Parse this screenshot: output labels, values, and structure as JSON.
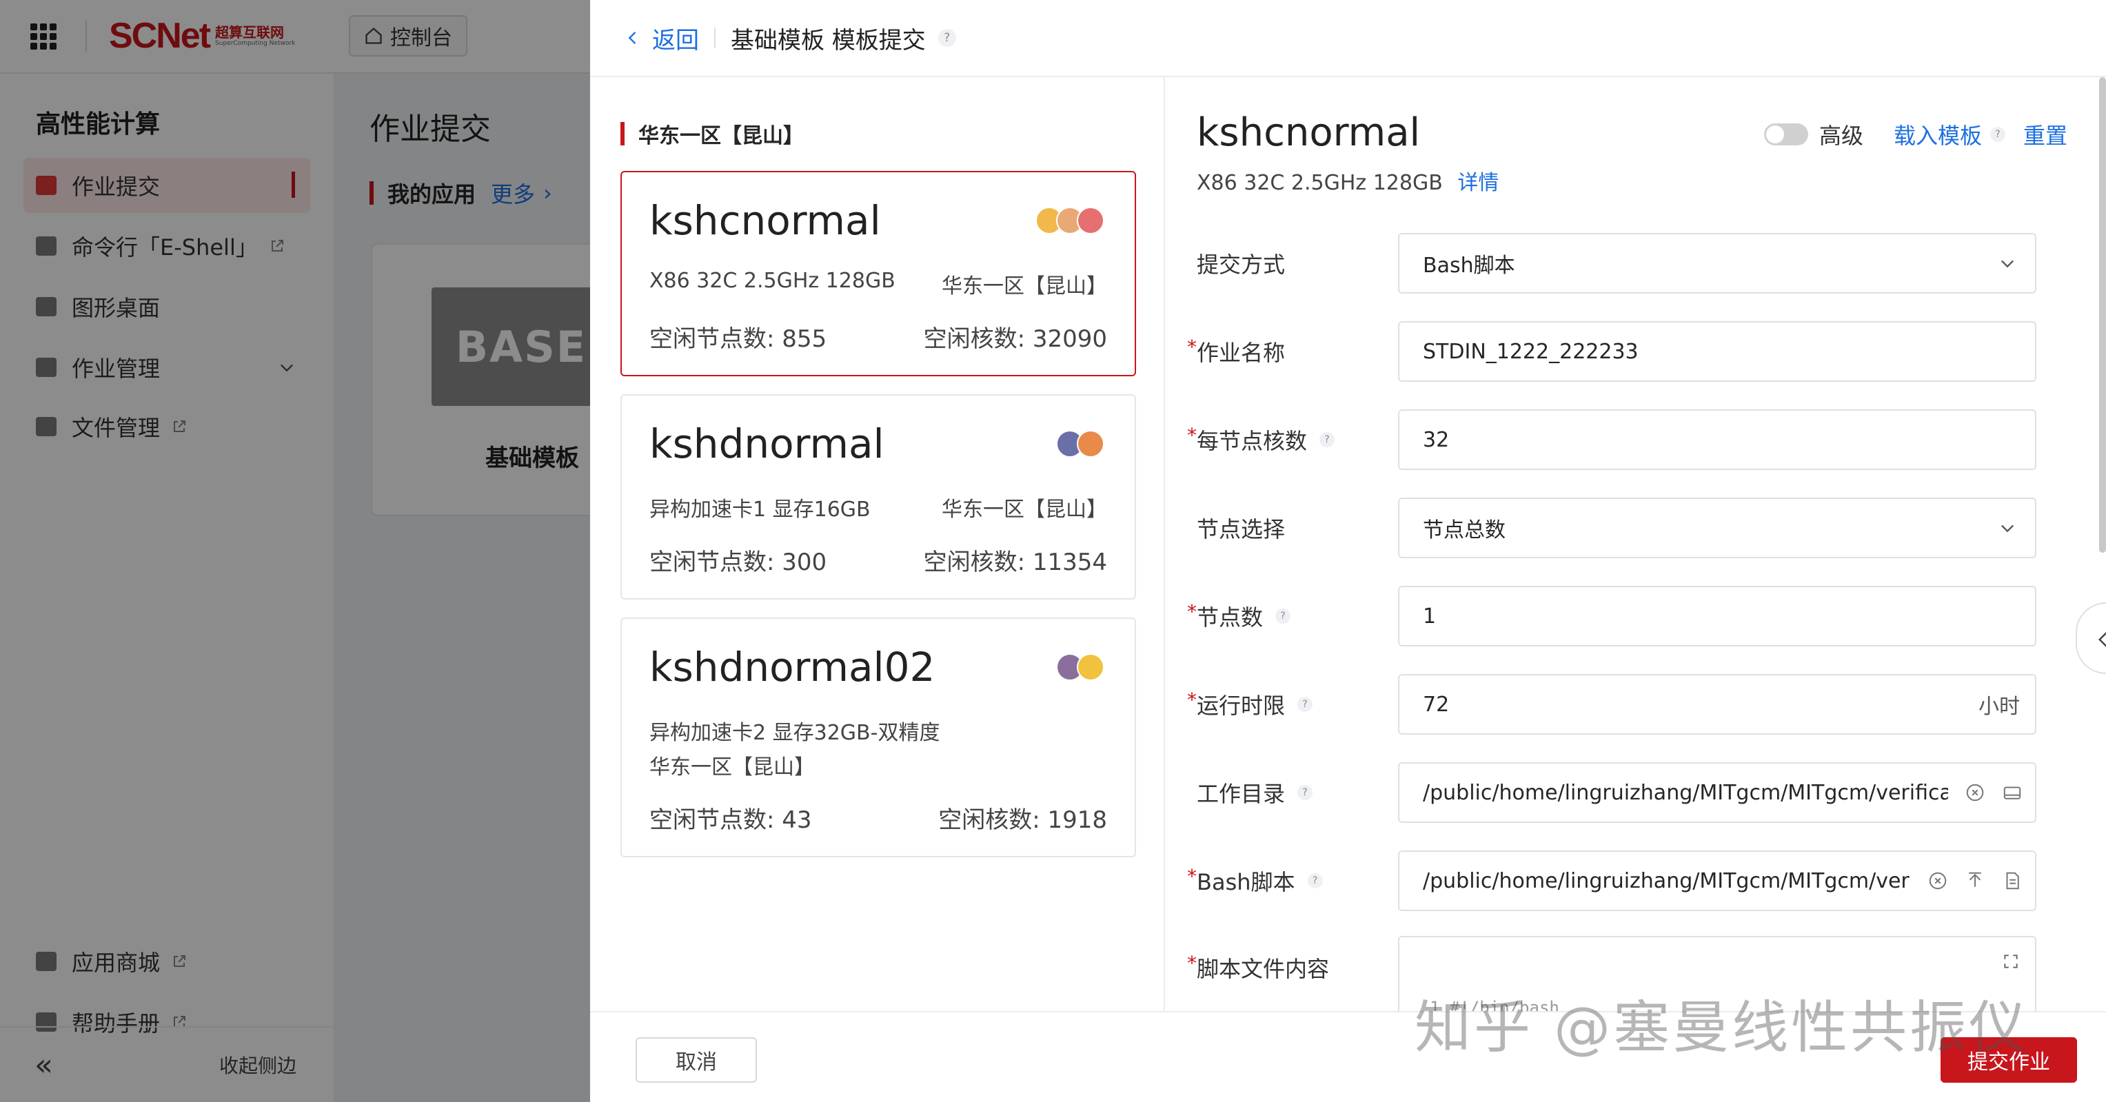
{
  "topbar": {
    "logo_text": "SCNet",
    "logo_cn": "超算互联网",
    "logo_en": "SuperComputing Network",
    "console_label": "控制台"
  },
  "sidebar": {
    "title": "高性能计算",
    "items": [
      {
        "label": "作业提交",
        "active": true,
        "icon": "job-submit-icon"
      },
      {
        "label": "命令行「E-Shell」",
        "external": true,
        "icon": "terminal-icon"
      },
      {
        "label": "图形桌面",
        "icon": "desktop-icon"
      },
      {
        "label": "作业管理",
        "expandable": true,
        "icon": "job-manage-icon"
      },
      {
        "label": "文件管理",
        "external": true,
        "icon": "folder-icon"
      },
      {
        "label": "应用商城",
        "external": true,
        "icon": "store-icon"
      },
      {
        "label": "帮助手册",
        "external": true,
        "icon": "help-book-icon"
      }
    ],
    "collapse_label": "收起侧边"
  },
  "main": {
    "title": "作业提交",
    "my_apps_label": "我的应用",
    "more_label": "更多",
    "app_thumb_text": "BASE",
    "app_name": "基础模板"
  },
  "drawer": {
    "back_label": "返回",
    "title": "基础模板 模板提交",
    "region": "华东一区【昆山】",
    "queues": [
      {
        "name": "kshcnormal",
        "spec": "X86 32C 2.5GHz 128GB",
        "region": "华东一区【昆山】",
        "idle_nodes": "空闲节点数: 855",
        "idle_cores": "空闲核数: 32090",
        "selected": true
      },
      {
        "name": "kshdnormal",
        "spec": "异构加速卡1 显存16GB",
        "region": "华东一区【昆山】",
        "idle_nodes": "空闲节点数: 300",
        "idle_cores": "空闲核数: 11354"
      },
      {
        "name": "kshdnormal02",
        "spec": "异构加速卡2 显存32GB-双精度",
        "region": "华东一区【昆山】",
        "idle_nodes": "空闲节点数: 43",
        "idle_cores": "空闲核数: 1918"
      }
    ],
    "selected_queue": {
      "name": "kshcnormal",
      "spec": "X86 32C 2.5GHz 128GB",
      "detail_link": "详情"
    },
    "actions": {
      "advanced_label": "高级",
      "load_template_label": "载入模板",
      "reset_label": "重置"
    },
    "form": {
      "submit_method": {
        "label": "提交方式",
        "value": "Bash脚本"
      },
      "job_name": {
        "label": "作业名称",
        "value": "STDIN_1222_222233"
      },
      "cores_per_node": {
        "label": "每节点核数",
        "value": "32"
      },
      "node_select": {
        "label": "节点选择",
        "value": "节点总数"
      },
      "node_count": {
        "label": "节点数",
        "value": "1"
      },
      "run_time": {
        "label": "运行时限",
        "value": "72",
        "suffix": "小时"
      },
      "work_dir": {
        "label": "工作目录",
        "value": "/public/home/lingruizhang/MITgcm/MITgcm/verificatic"
      },
      "bash_script": {
        "label": "Bash脚本",
        "value": "/public/home/lingruizhang/MITgcm/MITgcm/verificatic"
      },
      "script_content": {
        "label": "脚本文件内容",
        "code": "1 #!/bin/bash"
      }
    },
    "footer": {
      "cancel_label": "取消",
      "submit_label": "提交作业"
    }
  },
  "watermark": "知乎 @塞曼线性共振仪",
  "colors": {
    "brand_red": "#c8161d",
    "link_blue": "#1e6fe0"
  }
}
